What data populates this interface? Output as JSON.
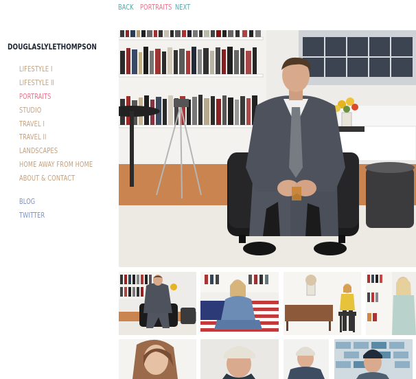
{
  "nav": {
    "back": "BACK",
    "current": "PORTRAITS",
    "next": "NEXT"
  },
  "site_title": "DOUGLASLYLETHOMPSON",
  "menu": {
    "items": [
      {
        "label": "LIFESTYLE I"
      },
      {
        "label": "LIFESTYLE II"
      },
      {
        "label": "PORTRAITS"
      },
      {
        "label": "STUDIO"
      },
      {
        "label": "TRAVEL I"
      },
      {
        "label": "TRAVEL II"
      },
      {
        "label": "LANDSCAPES"
      },
      {
        "label": "HOME AWAY FROM HOME"
      },
      {
        "label": "ABOUT & CONTACT"
      }
    ],
    "links": [
      {
        "label": "BLOG"
      },
      {
        "label": "TWITTER"
      }
    ]
  },
  "colors": {
    "nav_teal": "#57a6a6",
    "active_pink": "#e8728a",
    "menu_tan": "#c2a07f",
    "link_blue": "#7d8fc4",
    "title_navy": "#1f2633"
  }
}
